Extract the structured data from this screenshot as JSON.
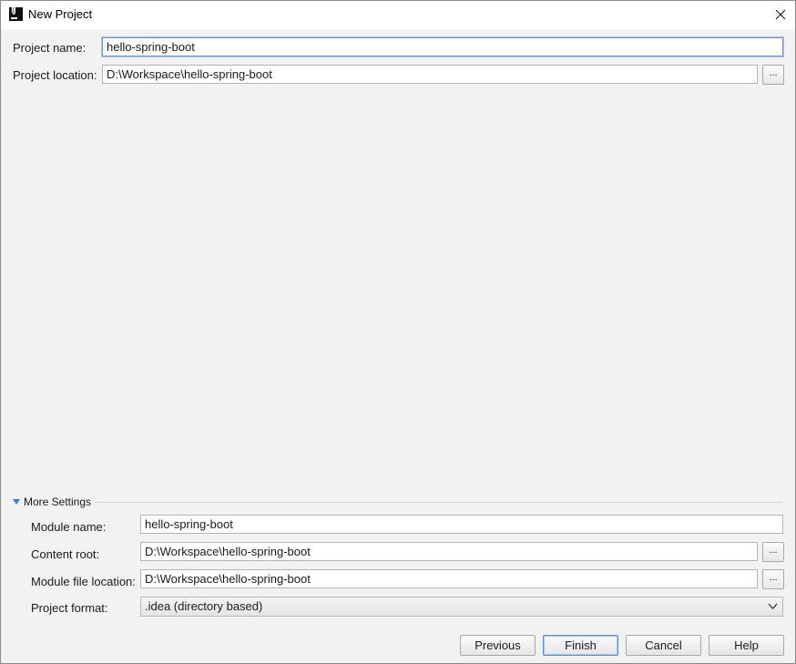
{
  "window": {
    "title": "New Project",
    "app_icon": "intellij-idea-icon",
    "close_icon": "close-icon"
  },
  "form": {
    "project_name": {
      "label": "Project name:",
      "value": "hello-spring-boot"
    },
    "project_location": {
      "label": "Project location:",
      "value": "D:\\Workspace\\hello-spring-boot",
      "browse_label": "..."
    }
  },
  "more_settings": {
    "label": "More Settings",
    "expanded": true,
    "toggle_icon": "triangle-down-icon",
    "module_name": {
      "label": "Module name:",
      "value": "hello-spring-boot"
    },
    "content_root": {
      "label": "Content root:",
      "value": "D:\\Workspace\\hello-spring-boot",
      "browse_label": "..."
    },
    "module_file_location": {
      "label": "Module file location:",
      "value": "D:\\Workspace\\hello-spring-boot",
      "browse_label": "..."
    },
    "project_format": {
      "label": "Project format:",
      "selected": ".idea (directory based)"
    }
  },
  "buttons": {
    "previous": "Previous",
    "finish": "Finish",
    "cancel": "Cancel",
    "help": "Help"
  },
  "colors": {
    "focus_border": "#6496d4",
    "accent_triangle": "#3c7fd0",
    "dialog_background": "#f2f2f2"
  }
}
